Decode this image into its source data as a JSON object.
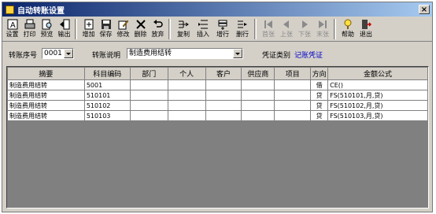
{
  "window": {
    "title": "自动转账设置",
    "close_label": "×"
  },
  "toolbar": [
    {
      "label": "设置",
      "icon": "settings-icon"
    },
    {
      "label": "打印",
      "icon": "printer-icon"
    },
    {
      "label": "预览",
      "icon": "preview-icon"
    },
    {
      "label": "输出",
      "icon": "export-icon"
    },
    {
      "label": "增加",
      "icon": "add-icon"
    },
    {
      "label": "保存",
      "icon": "save-icon"
    },
    {
      "label": "修改",
      "icon": "edit-icon"
    },
    {
      "label": "删除",
      "icon": "delete-icon"
    },
    {
      "label": "放弃",
      "icon": "undo-icon"
    },
    {
      "label": "复制",
      "icon": "copy-icon"
    },
    {
      "label": "插入",
      "icon": "insert-icon"
    },
    {
      "label": "增行",
      "icon": "add-row-icon"
    },
    {
      "label": "删行",
      "icon": "delete-row-icon"
    },
    {
      "label": "首张",
      "icon": "first-icon"
    },
    {
      "label": "上张",
      "icon": "prev-icon"
    },
    {
      "label": "下张",
      "icon": "next-icon"
    },
    {
      "label": "末张",
      "icon": "last-icon"
    },
    {
      "label": "帮助",
      "icon": "help-icon"
    },
    {
      "label": "退出",
      "icon": "exit-icon"
    }
  ],
  "form": {
    "seq_label": "转账序号",
    "seq_value": "0001",
    "desc_label": "转账说明",
    "desc_value": "制造费用结转",
    "voucher_label": "凭证类别",
    "voucher_value": "记账凭证"
  },
  "table": {
    "headers": [
      "摘要",
      "科目编码",
      "部门",
      "个人",
      "客户",
      "供应商",
      "项目",
      "方向",
      "金额公式"
    ],
    "rows": [
      [
        "制造费用结转",
        "5001",
        "",
        "",
        "",
        "",
        "",
        "借",
        "CE()"
      ],
      [
        "制造费用结转",
        "510101",
        "",
        "",
        "",
        "",
        "",
        "贷",
        "FS(510101,月,贷)"
      ],
      [
        "制造费用结转",
        "510102",
        "",
        "",
        "",
        "",
        "",
        "贷",
        "FS(510102,月,贷)"
      ],
      [
        "制造费用结转",
        "510103",
        "",
        "",
        "",
        "",
        "",
        "贷",
        "FS(510103,月,贷)"
      ]
    ]
  },
  "colors": {
    "title_start": "#0a246a",
    "title_end": "#a6caf0",
    "link": "#0000c8",
    "panel": "#d4d0c8"
  }
}
